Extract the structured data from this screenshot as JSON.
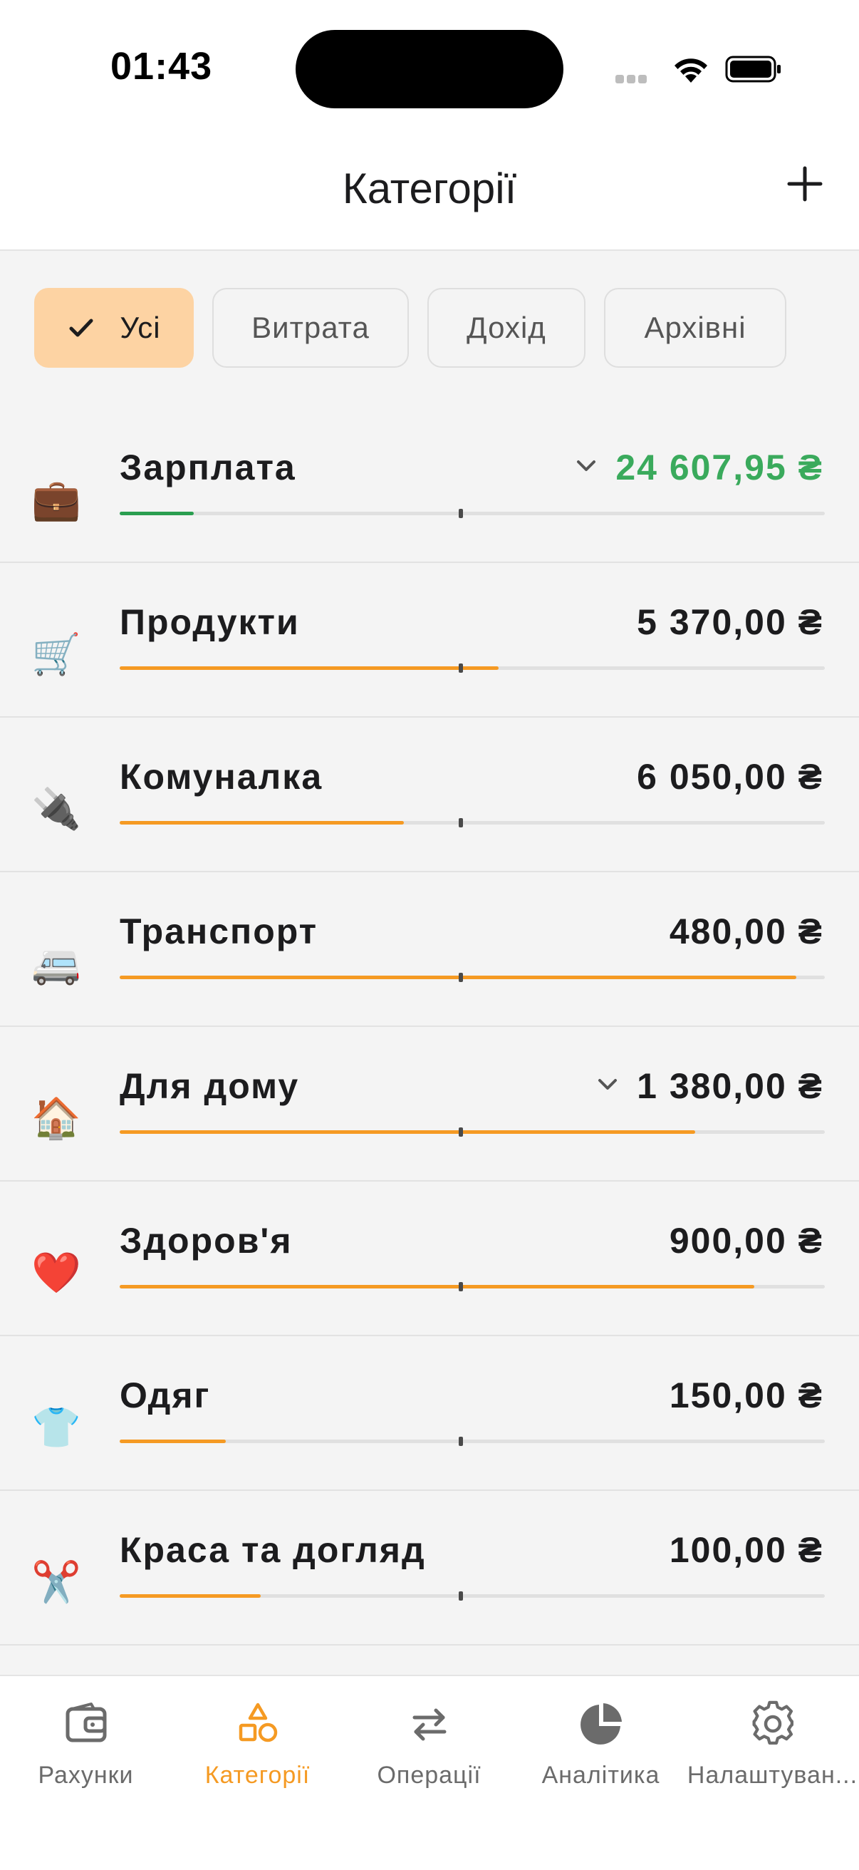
{
  "status_bar": {
    "time": "01:43"
  },
  "header": {
    "title": "Категорії",
    "add_icon": "plus-icon"
  },
  "filters": [
    {
      "label": "Усі",
      "selected": true
    },
    {
      "label": "Витрата",
      "selected": false
    },
    {
      "label": "Дохід",
      "selected": false
    },
    {
      "label": "Архівні",
      "selected": false
    }
  ],
  "categories": [
    {
      "icon": "💼",
      "icon_name": "briefcase-icon",
      "name": "Зарплата",
      "amount": "24 607,95 ₴",
      "type": "income",
      "has_subcategories": true,
      "progress": 0.105
    },
    {
      "icon": "🛒",
      "icon_name": "shopping-cart-icon",
      "name": "Продукти",
      "amount": "5 370,00 ₴",
      "type": "expense",
      "has_subcategories": false,
      "progress": 0.537
    },
    {
      "icon": "🔌",
      "icon_name": "electric-plug-icon",
      "name": "Комуналка",
      "amount": "6 050,00 ₴",
      "type": "expense",
      "has_subcategories": false,
      "progress": 0.403
    },
    {
      "icon": "🚐",
      "icon_name": "minibus-icon",
      "name": "Транспорт",
      "amount": "480,00 ₴",
      "type": "expense",
      "has_subcategories": false,
      "progress": 0.96
    },
    {
      "icon": "🏠",
      "icon_name": "house-icon",
      "name": "Для дому",
      "amount": "1 380,00 ₴",
      "type": "expense",
      "has_subcategories": true,
      "progress": 0.816
    },
    {
      "icon": "❤️",
      "icon_name": "heart-icon",
      "name": "Здоров'я",
      "amount": "900,00 ₴",
      "type": "expense",
      "has_subcategories": false,
      "progress": 0.9
    },
    {
      "icon": "👕",
      "icon_name": "tshirt-icon",
      "name": "Одяг",
      "amount": "150,00 ₴",
      "type": "expense",
      "has_subcategories": false,
      "progress": 0.15
    },
    {
      "icon": "✂️",
      "icon_name": "scissors-icon",
      "name": "Краса та догляд",
      "amount": "100,00 ₴",
      "type": "expense",
      "has_subcategories": false,
      "progress": 0.2
    }
  ],
  "tabbar": {
    "items": [
      {
        "label": "Рахунки",
        "icon": "wallet-icon",
        "active": false
      },
      {
        "label": "Категорії",
        "icon": "shapes-icon",
        "active": true
      },
      {
        "label": "Операції",
        "icon": "transfer-arrows-icon",
        "active": false
      },
      {
        "label": "Аналітика",
        "icon": "pie-chart-icon",
        "active": false
      },
      {
        "label": "Налаштуван...",
        "icon": "gear-icon",
        "active": false
      }
    ]
  },
  "colors": {
    "accent": "#f59a23",
    "income": "#3aaa5c",
    "chip_active": "#fdd3a3",
    "background": "#f4f4f4"
  }
}
